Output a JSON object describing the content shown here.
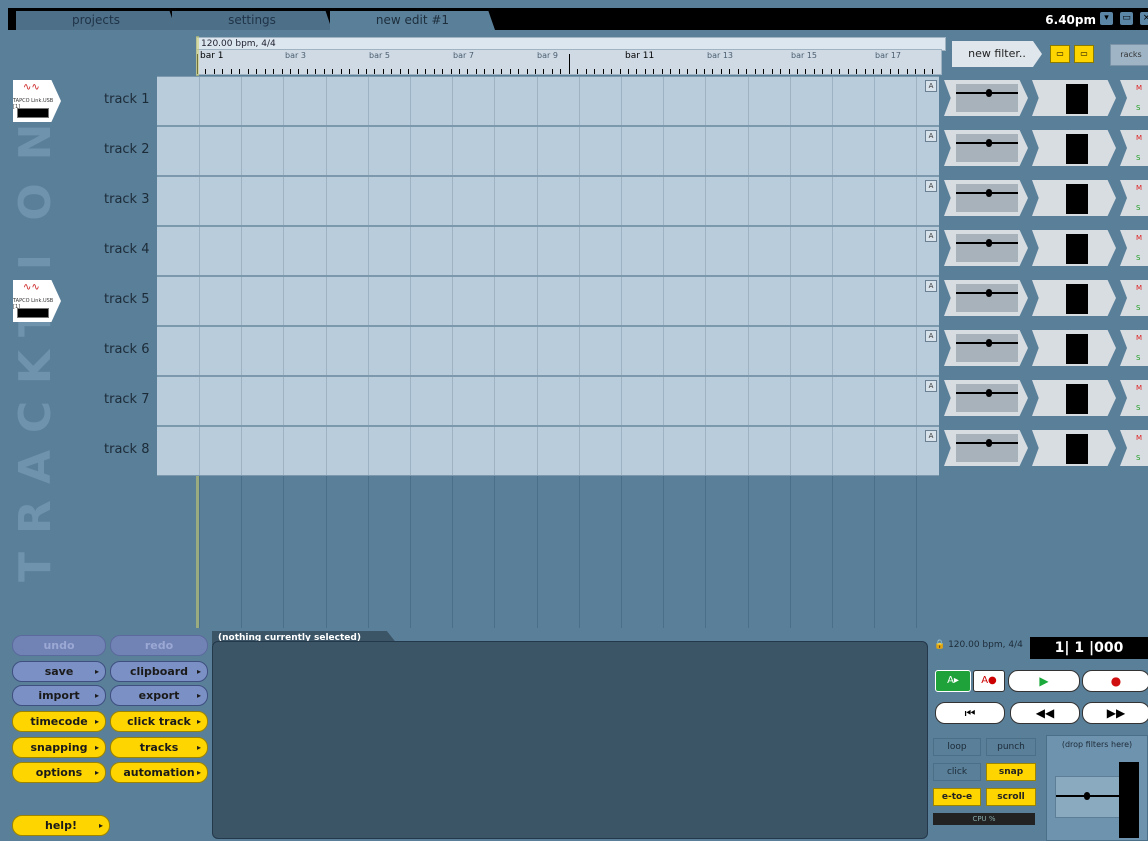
{
  "tabs": [
    {
      "label": "projects",
      "active": false
    },
    {
      "label": "settings",
      "active": false
    },
    {
      "label": "new edit #1",
      "active": true
    }
  ],
  "clock": "6.40pm",
  "ruler": {
    "tempo_label": "120.00 bpm, 4/4",
    "bars": [
      "bar 1",
      "bar 3",
      "bar 5",
      "bar 7",
      "bar 9",
      "bar 11",
      "bar 13",
      "bar 15",
      "bar 17"
    ]
  },
  "tracks": [
    {
      "name": "track 1",
      "has_input": true,
      "input_label": "TAPCO Link.USB [1]"
    },
    {
      "name": "track 2",
      "has_input": false
    },
    {
      "name": "track 3",
      "has_input": false
    },
    {
      "name": "track 4",
      "has_input": false
    },
    {
      "name": "track 5",
      "has_input": true,
      "input_label": "TAPCO Link.USB [1]"
    },
    {
      "name": "track 6",
      "has_input": false
    },
    {
      "name": "track 7",
      "has_input": false
    },
    {
      "name": "track 8",
      "has_input": false
    }
  ],
  "track_controls": {
    "auto": "A",
    "mute": "M",
    "solo": "S"
  },
  "right_header": {
    "new_filter": "new filter..",
    "racks": "racks"
  },
  "logo": "TRACKTION",
  "left_buttons": {
    "undo": "undo",
    "redo": "redo",
    "save": "save",
    "clipboard": "clipboard",
    "import": "import",
    "export": "export",
    "timecode": "timecode",
    "click_track": "click track",
    "snapping": "snapping",
    "tracks": "tracks",
    "options": "options",
    "automation": "automation",
    "help": "help!"
  },
  "properties": {
    "tab": "(nothing currently selected)"
  },
  "transport": {
    "tempo": "120.00 bpm, 4/4",
    "position": "1| 1 |000",
    "toggles": {
      "loop": "loop",
      "punch": "punch",
      "click": "click",
      "snap": "snap",
      "e_to_e": "e-to-e",
      "scroll": "scroll"
    },
    "cpu": "CPU %",
    "drop_filters": "(drop filters here)"
  },
  "colors": {
    "accent_yellow": "#ffd500",
    "panel_bg": "#5a7f99",
    "track_bg": "#b9ccdb",
    "button_blue": "#7b90c4"
  }
}
